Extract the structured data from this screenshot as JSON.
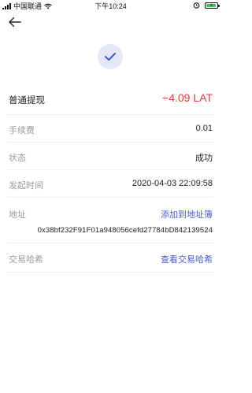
{
  "status_bar": {
    "carrier": "中国联通",
    "time": "下午10:24"
  },
  "record": {
    "title": "普通提现",
    "amount": "−4.09 LAT",
    "fee_label": "手续费",
    "fee_value": "0.01",
    "status_label": "状态",
    "status_value": "成功",
    "time_label": "发起时间",
    "time_value": "2020-04-03 22:09:58",
    "address_label": "地址",
    "address_action": "添加到地址簿",
    "address_value": "0x38bf232F91F01a948056cefd27784bD842139524",
    "hash_label": "交易哈希",
    "hash_action": "查看交易哈希"
  },
  "colors": {
    "amount": "#e33b3b",
    "link": "#4a5ad4",
    "success_bg": "#e6e8f7",
    "success_check": "#4a5ad4"
  }
}
